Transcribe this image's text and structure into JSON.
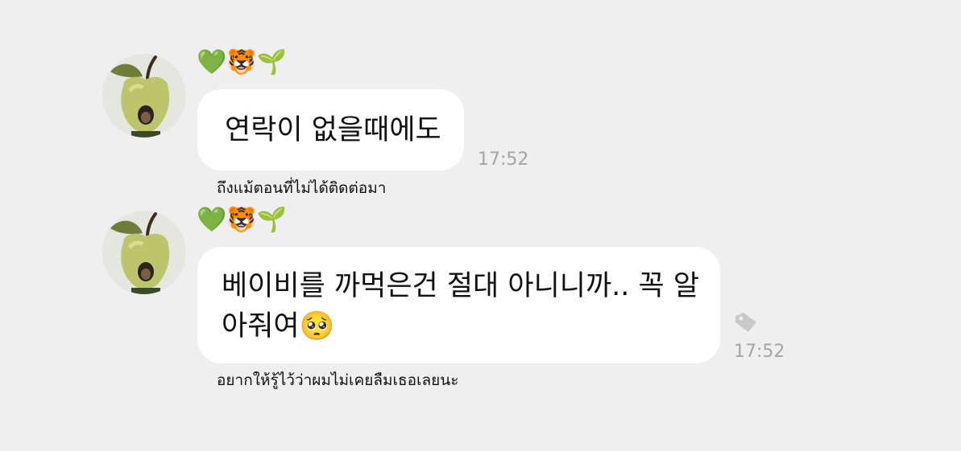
{
  "messages": [
    {
      "sender_emoji": [
        "💚",
        "🐯",
        "🌱"
      ],
      "text": "연락이 없을때에도",
      "time": "17:52",
      "translation": "ถึงแม้ตอนที่ไม่ได้ติดต่อมา"
    },
    {
      "sender_emoji": [
        "💚",
        "🐯",
        "🌱"
      ],
      "text_line1": "베이비를 까먹은건 절대 아니니까.. 꼭 알",
      "text_line2": "아줘여",
      "pleading_emoji": "🥺",
      "time": "17:52",
      "translation": "อยากให้รู้ไว้ว่าผมไม่เคยลืมเธอเลยนะ"
    }
  ],
  "icons": {
    "avatar": "apple-avatar-icon",
    "tag": "price-tag-icon"
  },
  "colors": {
    "background": "#efefef",
    "bubble": "#ffffff",
    "time": "#a5a5a5",
    "heart": "#2ee59d"
  }
}
